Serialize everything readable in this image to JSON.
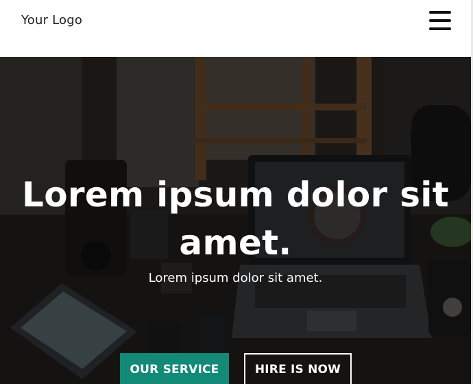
{
  "header": {
    "logo_text": "Your Logo",
    "menu_icon": "hamburger-menu-icon"
  },
  "hero": {
    "title": "Lorem ipsum dolor sit amet.",
    "subtitle": "Lorem ipsum dolor sit amet.",
    "buttons": {
      "primary_label": "OUR SERVICE",
      "secondary_label": "HIRE IS NOW"
    },
    "background": "photo of desk with laptop, tablet, phones",
    "colors": {
      "accent": "#138a77",
      "overlay": "#000000",
      "text": "#ffffff"
    }
  }
}
